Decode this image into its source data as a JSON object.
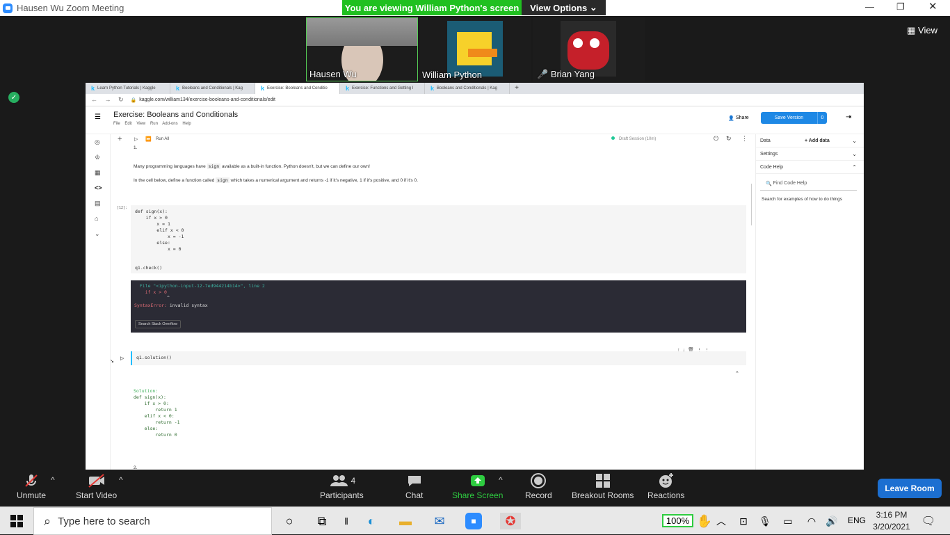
{
  "zoom": {
    "window_title": "Hausen Wu   Zoom Meeting",
    "banner": "You are viewing William Python's screen",
    "view_options": "View Options",
    "view_label": "View",
    "participants": [
      {
        "name": "Hausen Wu"
      },
      {
        "name": "William Python"
      },
      {
        "name": "Brian Yang",
        "muted": true
      }
    ],
    "controls": [
      {
        "label": "Unmute",
        "icon": "mic-muted-icon"
      },
      {
        "label": "Start Video",
        "icon": "video-off-icon"
      },
      {
        "label": "Participants",
        "icon": "participants-icon",
        "count": "4"
      },
      {
        "label": "Chat",
        "icon": "chat-icon"
      },
      {
        "label": "Share Screen",
        "icon": "share-screen-icon"
      },
      {
        "label": "Record",
        "icon": "record-icon"
      },
      {
        "label": "Breakout Rooms",
        "icon": "breakout-rooms-icon"
      },
      {
        "label": "Reactions",
        "icon": "reactions-icon"
      }
    ],
    "leave": "Leave Room"
  },
  "browser": {
    "tabs": [
      "Learn Python Tutorials | Kaggle",
      "Booleans and Conditionals | Kag",
      "Exercise: Booleans and Conditio",
      "Exercise: Functions and Getting I",
      "Booleans and Conditionals | Kag"
    ],
    "url": "kaggle.com/william134/exercise-booleans-and-conditionals/edit"
  },
  "notebook": {
    "title": "Exercise: Booleans and Conditionals",
    "menu": [
      "File",
      "Edit",
      "View",
      "Run",
      "Add-ons",
      "Help"
    ],
    "share": "Share",
    "save_version": "Save Version",
    "save_count": "0",
    "run_all": "Run All",
    "session": "Draft Session (10m)",
    "md_num": "1.",
    "md1_a": "Many programming languages have ",
    "md1_code": "sign",
    "md1_b": " available as a built-in function. Python doesn't, but we can define our own!",
    "md2_a": "In the cell below, define a function called ",
    "md2_code": "sign",
    "md2_b": " which takes a numerical argument and returns -1 if it's negative, 1 if it's positive, and 0 if it's 0.",
    "cell_prompt": "[12]:",
    "code": "def sign(x):\n    if x > 0\n        x = 1\n        elif x < 0\n            x = -1\n        else:\n            x = 0\n\n\nq1.check()",
    "err_line1": "  File \"<ipython-input-12-7ed944214b14>\", line 2",
    "err_line2": "    if x > 0",
    "err_line3": "            ^",
    "err_type": "SyntaxError:",
    "err_msg": " invalid syntax",
    "stack_btn": "Search Stack Overflow",
    "cell2_code": "q1.solution()",
    "sol_label": "Solution:",
    "sol_code": "def sign(x):\n    if x > 0:\n        return 1\n    elif x < 0:\n        return -1\n    else:\n        return 0",
    "next_num": "2."
  },
  "right_panel": {
    "data": "Data",
    "add_data": "Add data",
    "settings": "Settings",
    "code_help": "Code Help",
    "find_placeholder": "Find Code Help",
    "search_hint": "Search for examples of how to do things"
  },
  "taskbar": {
    "search_placeholder": "Type here to search",
    "battery": "100%",
    "lang": "ENG",
    "time": "3:16 PM",
    "date": "3/20/2021"
  }
}
